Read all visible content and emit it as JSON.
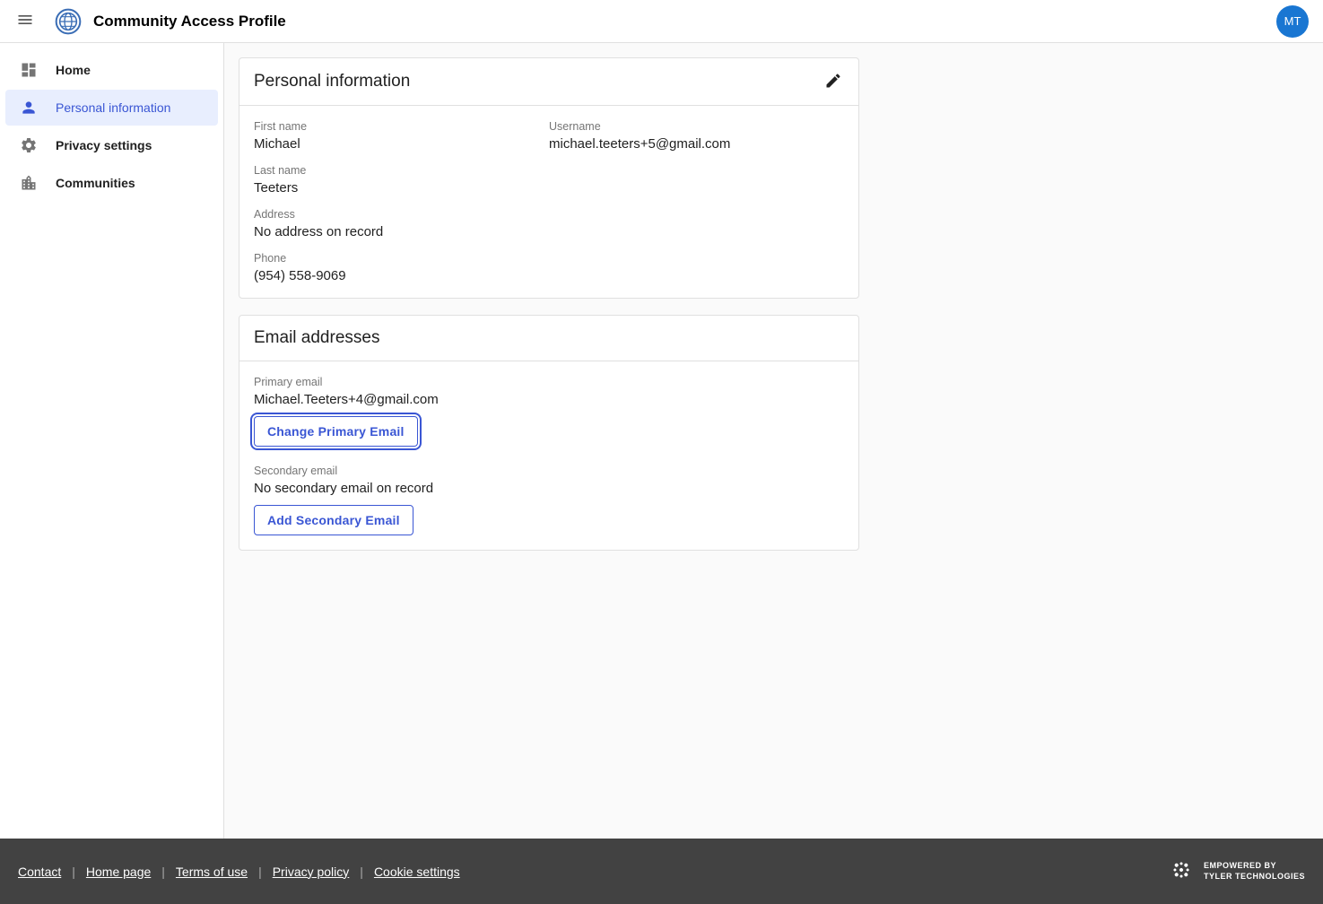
{
  "header": {
    "title": "Community Access Profile",
    "avatar_initials": "MT"
  },
  "sidebar": {
    "items": [
      {
        "label": "Home",
        "icon": "dashboard",
        "active": false
      },
      {
        "label": "Personal information",
        "icon": "person",
        "active": true
      },
      {
        "label": "Privacy settings",
        "icon": "gear",
        "active": false
      },
      {
        "label": "Communities",
        "icon": "building",
        "active": false
      }
    ]
  },
  "personal_info": {
    "title": "Personal information",
    "first_name_label": "First name",
    "first_name": "Michael",
    "last_name_label": "Last name",
    "last_name": "Teeters",
    "username_label": "Username",
    "username": "michael.teeters+5@gmail.com",
    "address_label": "Address",
    "address": "No address on record",
    "phone_label": "Phone",
    "phone": "(954) 558-9069"
  },
  "email_card": {
    "title": "Email addresses",
    "primary_label": "Primary email",
    "primary_value": "Michael.Teeters+4@gmail.com",
    "change_primary_btn": "Change Primary Email",
    "secondary_label": "Secondary email",
    "secondary_value": "No secondary email on record",
    "add_secondary_btn": "Add Secondary Email"
  },
  "footer": {
    "links": [
      "Contact",
      "Home page",
      "Terms of use",
      "Privacy policy",
      "Cookie settings"
    ],
    "brand_line1": "EMPOWERED BY",
    "brand_line2": "TYLER TECHNOLOGIES"
  }
}
